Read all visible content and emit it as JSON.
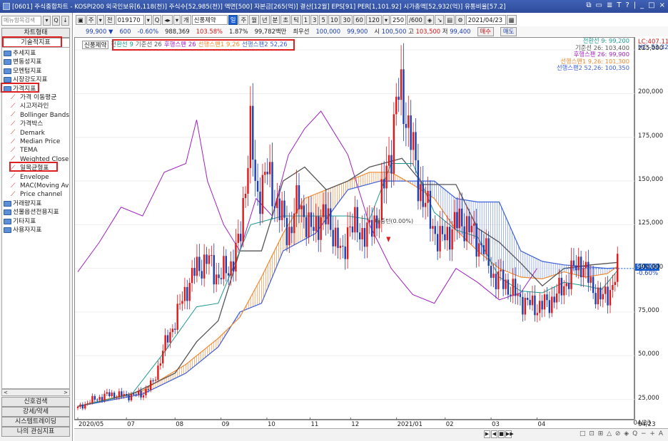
{
  "window": {
    "title": "[0601] 주식종합차트 - KOSPI200 외국인보유[6,118(천)] 주식수[52,985(천)] 액면[500] 자본금[265(억)] 결산[12월] EPS[91] PER[1,101.92] 시가총액[52,932(억)] 유통비율[57.2]",
    "buttons": [
      "⧉",
      "▭",
      "≣",
      "T",
      "?",
      "|",
      "_",
      "□",
      "×"
    ]
  },
  "left": {
    "search_placeholder": "메뉴항목검색",
    "btn_search": "▾",
    "btn_find": "Q",
    "btn_down": "↓",
    "tab_chart": "차트형태",
    "tab_tech": "기술적지표",
    "tree": [
      {
        "label": "추세지표",
        "type": "folder",
        "indent": 0
      },
      {
        "label": "변동성지표",
        "type": "folder",
        "indent": 0
      },
      {
        "label": "모멘텀지표",
        "type": "folder",
        "indent": 0
      },
      {
        "label": "시장강도지표",
        "type": "folder",
        "indent": 0
      },
      {
        "label": "가격지표",
        "type": "folder",
        "indent": 0
      },
      {
        "label": "가격 이동평균",
        "type": "item",
        "indent": 1
      },
      {
        "label": "시고저라인",
        "type": "item",
        "indent": 1
      },
      {
        "label": "Bollinger Bands",
        "type": "item",
        "indent": 1
      },
      {
        "label": "가격박스",
        "type": "item",
        "indent": 1
      },
      {
        "label": "Demark",
        "type": "item",
        "indent": 1
      },
      {
        "label": "Median Price",
        "type": "item",
        "indent": 1
      },
      {
        "label": "TEMA",
        "type": "item",
        "indent": 1
      },
      {
        "label": "Weighted Close",
        "type": "item",
        "indent": 1
      },
      {
        "label": "일목균형표",
        "type": "item",
        "indent": 1
      },
      {
        "label": "Envelope",
        "type": "item",
        "indent": 1
      },
      {
        "label": "MAC(Moving Average Channel)",
        "type": "item",
        "indent": 1
      },
      {
        "label": "Price channel",
        "type": "item",
        "indent": 1
      },
      {
        "label": "거래량지표",
        "type": "folder",
        "indent": 0
      },
      {
        "label": "선물옵션전용지표",
        "type": "folder",
        "indent": 0
      },
      {
        "label": "기타지표",
        "type": "folder",
        "indent": 0
      },
      {
        "label": "사용자지표",
        "type": "folder",
        "indent": 0
      }
    ],
    "scroll_left": "<",
    "scroll_right": ">",
    "bottom_buttons": [
      "신호검색",
      "강세/약세",
      "시스템트레이딩",
      "나의 관심지표"
    ]
  },
  "toolbar1": {
    "items": [
      "▣",
      "주",
      "▾",
      "전",
      "019170",
      "▾",
      "Q",
      "◂▸",
      "▾",
      "개",
      "신풍제약",
      "일",
      "주",
      "월",
      "년",
      "분",
      "초",
      "틱",
      "1",
      "3",
      "5",
      "10",
      "30",
      "60",
      "120",
      "▾",
      "250",
      "/600",
      "◈",
      "↘",
      "▤",
      "⚙",
      "2021/04/23",
      "▦"
    ],
    "active": "일"
  },
  "toolbar2": {
    "price": "99,900",
    "arrow": "▼",
    "change": "600",
    "pct": "-0.60%",
    "volume": "988,369",
    "vol_pct": "103.58%",
    "rate": "1.87%",
    "amount": "99,782백만",
    "quote_label": "최우선",
    "ask": "100,000",
    "bid": "99,900",
    "open_label": "시",
    "open": "100,500",
    "high_label": "고",
    "high": "103,500",
    "low_label": "저",
    "low": "99,400",
    "buy": "매수",
    "sell": "매도"
  },
  "chart": {
    "name_tag": "신풍제약",
    "legend": [
      {
        "label": "전환선 9",
        "color": "#1a9a90"
      },
      {
        "label": "기준선 26",
        "color": "#555555"
      },
      {
        "label": "후행스팬 26",
        "color": "#a020c0"
      },
      {
        "label": "선행스팬1 9,26",
        "color": "#f08a30"
      },
      {
        "label": "선행스팬2 52,26",
        "color": "#3a5fd8"
      }
    ],
    "right_legend": [
      {
        "label": "전환선 9: 99,200",
        "color": "#1a9a90"
      },
      {
        "label": "기준선 26: 103,400",
        "color": "#555555"
      },
      {
        "label": "후행스팬 26: 99,900",
        "color": "#a020c0"
      },
      {
        "label": "선행스팬1 9,26: 101,300",
        "color": "#f08a30"
      },
      {
        "label": "선행스팬2 52,26: 100,350",
        "color": "#3a5fd8"
      }
    ],
    "annotation": "배중턴(0.00%)",
    "lc": "LC:407.11",
    "hc": "HC:-53.32",
    "current_price": "99,900",
    "current_pct": "-0.60%",
    "last_date": "04/23"
  },
  "chart_data": {
    "type": "candlestick",
    "title": "신풍제약",
    "x": [
      "2020/05",
      "07",
      "08",
      "09",
      "10",
      "11",
      "12",
      "2021/01",
      "02",
      "03",
      "04"
    ],
    "y_ticks": [
      25000,
      50000,
      75000,
      100000,
      125000,
      150000,
      175000,
      200000,
      225000
    ],
    "ylim": [
      13000,
      232000
    ],
    "series": [
      {
        "name": "가격",
        "points": [
          [
            0,
            20000
          ],
          [
            0.03,
            25000
          ],
          [
            0.06,
            28000
          ],
          [
            0.09,
            27000
          ],
          [
            0.12,
            28000
          ],
          [
            0.14,
            35000
          ],
          [
            0.16,
            55000
          ],
          [
            0.18,
            70000
          ],
          [
            0.2,
            88000
          ],
          [
            0.22,
            100000
          ],
          [
            0.24,
            105000
          ],
          [
            0.26,
            95000
          ],
          [
            0.28,
            100000
          ],
          [
            0.3,
            115000
          ],
          [
            0.31,
            150000
          ],
          [
            0.32,
            180000
          ],
          [
            0.33,
            140000
          ],
          [
            0.35,
            155000
          ],
          [
            0.37,
            135000
          ],
          [
            0.39,
            120000
          ],
          [
            0.41,
            140000
          ],
          [
            0.43,
            120000
          ],
          [
            0.45,
            130000
          ],
          [
            0.47,
            125000
          ],
          [
            0.49,
            105000
          ],
          [
            0.5,
            125000
          ],
          [
            0.52,
            122000
          ],
          [
            0.54,
            120000
          ],
          [
            0.56,
            135000
          ],
          [
            0.58,
            170000
          ],
          [
            0.59,
            195000
          ],
          [
            0.6,
            200000
          ],
          [
            0.61,
            185000
          ],
          [
            0.63,
            150000
          ],
          [
            0.65,
            130000
          ],
          [
            0.67,
            115000
          ],
          [
            0.69,
            122000
          ],
          [
            0.71,
            128000
          ],
          [
            0.73,
            120000
          ],
          [
            0.75,
            112000
          ],
          [
            0.77,
            95000
          ],
          [
            0.79,
            92000
          ],
          [
            0.81,
            85000
          ],
          [
            0.83,
            80000
          ],
          [
            0.85,
            78000
          ],
          [
            0.87,
            80000
          ],
          [
            0.89,
            86000
          ],
          [
            0.91,
            95000
          ],
          [
            0.93,
            105000
          ],
          [
            0.95,
            90000
          ],
          [
            0.97,
            82000
          ],
          [
            0.99,
            90000
          ],
          [
            1.0,
            99900
          ]
        ]
      },
      {
        "name": "전환선 9",
        "points": [
          [
            0,
            21000
          ],
          [
            0.1,
            28000
          ],
          [
            0.16,
            52000
          ],
          [
            0.22,
            78000
          ],
          [
            0.26,
            80000
          ],
          [
            0.32,
            125000
          ],
          [
            0.38,
            130000
          ],
          [
            0.44,
            130000
          ],
          [
            0.5,
            130000
          ],
          [
            0.54,
            128000
          ],
          [
            0.58,
            160000
          ],
          [
            0.62,
            160000
          ],
          [
            0.66,
            132000
          ],
          [
            0.7,
            122000
          ],
          [
            0.74,
            118000
          ],
          [
            0.78,
            95000
          ],
          [
            0.82,
            87000
          ],
          [
            0.86,
            86000
          ],
          [
            0.9,
            92000
          ],
          [
            0.94,
            90000
          ],
          [
            0.97,
            88000
          ],
          [
            1.0,
            99200
          ]
        ]
      },
      {
        "name": "기준선 26",
        "points": [
          [
            0,
            21000
          ],
          [
            0.1,
            28000
          ],
          [
            0.18,
            40000
          ],
          [
            0.22,
            58000
          ],
          [
            0.26,
            70000
          ],
          [
            0.3,
            110000
          ],
          [
            0.34,
            110000
          ],
          [
            0.38,
            150000
          ],
          [
            0.42,
            158000
          ],
          [
            0.46,
            145000
          ],
          [
            0.5,
            150000
          ],
          [
            0.54,
            158000
          ],
          [
            0.6,
            163000
          ],
          [
            0.64,
            148000
          ],
          [
            0.7,
            148000
          ],
          [
            0.74,
            123000
          ],
          [
            0.78,
            115000
          ],
          [
            0.82,
            103000
          ],
          [
            0.86,
            90000
          ],
          [
            0.9,
            100000
          ],
          [
            0.95,
            102000
          ],
          [
            1.0,
            103400
          ]
        ]
      },
      {
        "name": "후행스팬 26",
        "points": [
          [
            0,
            98000
          ],
          [
            0.04,
            115000
          ],
          [
            0.08,
            135000
          ],
          [
            0.12,
            130000
          ],
          [
            0.16,
            155000
          ],
          [
            0.2,
            160000
          ],
          [
            0.22,
            185000
          ],
          [
            0.24,
            150000
          ],
          [
            0.27,
            125000
          ],
          [
            0.3,
            110000
          ],
          [
            0.33,
            140000
          ],
          [
            0.36,
            130000
          ],
          [
            0.39,
            165000
          ],
          [
            0.42,
            180000
          ],
          [
            0.45,
            190000
          ],
          [
            0.48,
            175000
          ],
          [
            0.5,
            165000
          ],
          [
            0.54,
            125000
          ],
          [
            0.58,
            100000
          ],
          [
            0.62,
            85000
          ],
          [
            0.66,
            80000
          ],
          [
            0.7,
            100000
          ],
          [
            0.74,
            92000
          ],
          [
            0.78,
            82000
          ],
          [
            0.82,
            86000
          ],
          [
            0.85,
            99900
          ]
        ]
      },
      {
        "name": "선행스팬1 9,26",
        "points": [
          [
            0,
            21000
          ],
          [
            0.12,
            30000
          ],
          [
            0.2,
            45000
          ],
          [
            0.26,
            60000
          ],
          [
            0.3,
            72000
          ],
          [
            0.34,
            95000
          ],
          [
            0.38,
            120000
          ],
          [
            0.42,
            140000
          ],
          [
            0.46,
            145000
          ],
          [
            0.5,
            150000
          ],
          [
            0.54,
            155000
          ],
          [
            0.58,
            155000
          ],
          [
            0.62,
            148000
          ],
          [
            0.66,
            140000
          ],
          [
            0.7,
            122000
          ],
          [
            0.74,
            110000
          ],
          [
            0.78,
            100000
          ],
          [
            0.82,
            95000
          ],
          [
            0.86,
            94000
          ],
          [
            0.9,
            98000
          ],
          [
            0.94,
            95000
          ],
          [
            0.98,
            97000
          ],
          [
            1.0,
            101300
          ]
        ]
      },
      {
        "name": "선행스팬2 52,26",
        "points": [
          [
            0,
            21000
          ],
          [
            0.12,
            28000
          ],
          [
            0.2,
            40000
          ],
          [
            0.26,
            55000
          ],
          [
            0.3,
            75000
          ],
          [
            0.34,
            80000
          ],
          [
            0.38,
            110000
          ],
          [
            0.44,
            120000
          ],
          [
            0.5,
            145000
          ],
          [
            0.56,
            150000
          ],
          [
            0.62,
            150000
          ],
          [
            0.66,
            150000
          ],
          [
            0.7,
            140000
          ],
          [
            0.74,
            138000
          ],
          [
            0.78,
            138000
          ],
          [
            0.82,
            110000
          ],
          [
            0.86,
            104000
          ],
          [
            0.9,
            102000
          ],
          [
            0.94,
            101000
          ],
          [
            0.98,
            100000
          ],
          [
            1.0,
            100350
          ]
        ]
      }
    ]
  },
  "xaxis": {
    "labels": [
      "2020/05",
      "07",
      "08",
      "09",
      "10",
      "11",
      "12",
      "2021/01",
      "02",
      "03",
      "04",
      "04/23"
    ]
  },
  "yaxis": {
    "labels": [
      "225,000",
      "200,000",
      "175,000",
      "150,000",
      "125,000",
      "100,000",
      "75,000",
      "50,000",
      "25,000"
    ]
  },
  "bottom": {
    "nav": [
      "▶",
      "◀",
      "■",
      "▶▶"
    ],
    "tools": "□ ⊡ ⊞ △ ⊘ ◈ Q − + A"
  }
}
